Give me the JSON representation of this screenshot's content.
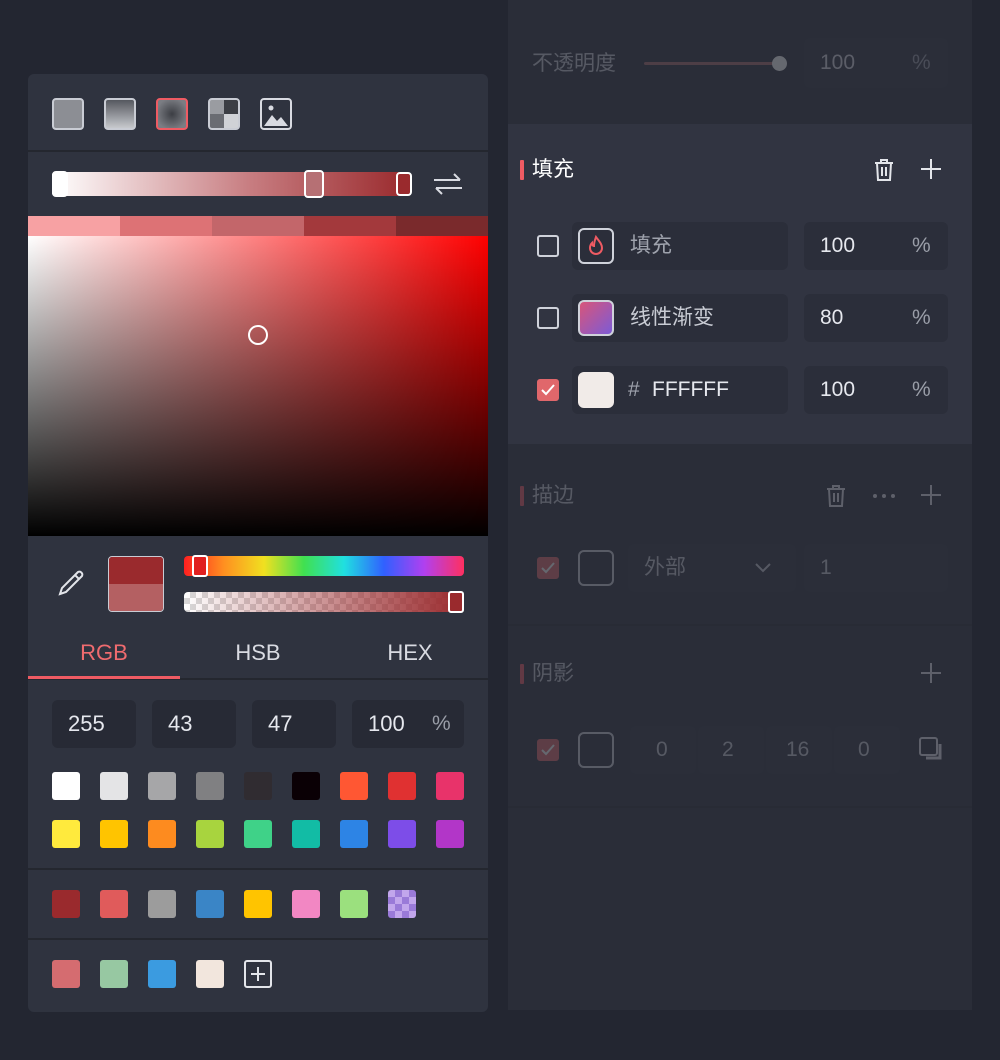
{
  "colors": {
    "accent": "#e0676b",
    "bg": "#232631",
    "panel": "#2f333f"
  },
  "opacity": {
    "label": "不透明度",
    "value": "100",
    "unit": "%"
  },
  "fill": {
    "title": "填充",
    "rows": [
      {
        "label": "填充",
        "value": "100",
        "unit": "%",
        "checked": false
      },
      {
        "label": "线性渐变",
        "value": "80",
        "unit": "%",
        "checked": false
      },
      {
        "hash": "#",
        "label": "FFFFFF",
        "value": "100",
        "unit": "%",
        "checked": true
      }
    ]
  },
  "stroke": {
    "title": "描边",
    "position": "外部",
    "width": "1"
  },
  "shadow": {
    "title": "阴影",
    "x": "0",
    "y": "2",
    "blur": "16",
    "spread": "0"
  },
  "picker": {
    "fill_types": [
      "solid-fill-icon",
      "linear-gradient-icon",
      "radial-gradient-icon",
      "angular-gradient-icon",
      "image-fill-icon"
    ],
    "tabs": [
      "RGB",
      "HSB",
      "HEX"
    ],
    "active_tab": "RGB",
    "rgb": {
      "r": "255",
      "g": "43",
      "b": "47",
      "a": "100",
      "unit": "%"
    },
    "current_color": "#9a2a2d",
    "hue": 0.03,
    "alpha": 1.0,
    "saturation": 0.5,
    "brightness": 0.67,
    "preset_swatches_row1": [
      "#ffffff",
      "#e4e4e6",
      "#a6a6a8",
      "#808082",
      "#302c31",
      "#0a0005",
      "#ff5733",
      "#e03131",
      "#e8336a"
    ],
    "preset_swatches_row2": [
      "#ffea3d",
      "#ffc400",
      "#fd8b1f",
      "#a8d43e",
      "#3fd288",
      "#12bca5",
      "#2d84e5",
      "#7d4de8",
      "#b236c8"
    ],
    "document_swatches": [
      "#9a2a2d",
      "#e05b5b",
      "#9c9c9c",
      "#3a85c6",
      "#ffc400",
      "#f287c3",
      "#9be07e",
      "checker-purple"
    ],
    "recent_swatches": [
      "#d56c70",
      "#97c8a2",
      "#3b9be0",
      "#f2e6dd"
    ]
  }
}
